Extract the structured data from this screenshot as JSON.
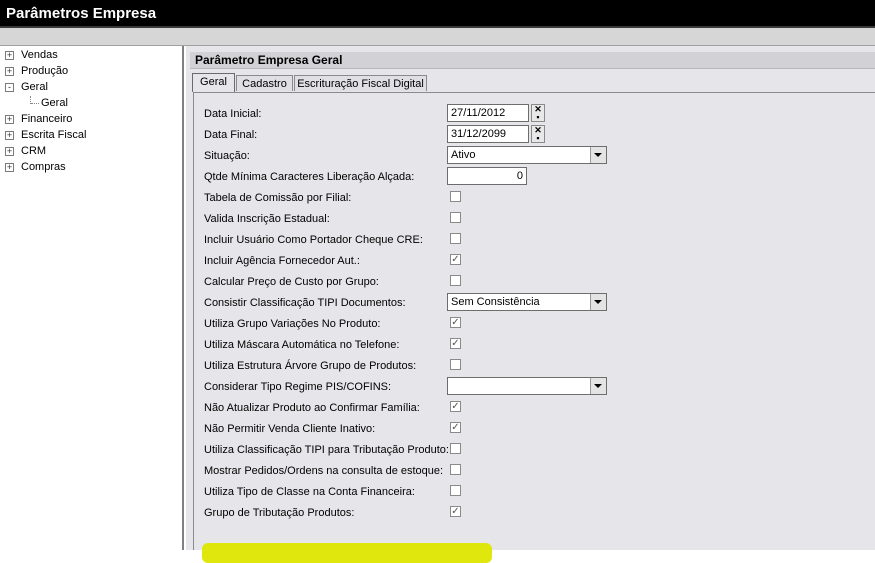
{
  "window": {
    "title": "Parâmetros Empresa"
  },
  "tree": {
    "items": [
      {
        "label": "Vendas",
        "expander": "+"
      },
      {
        "label": "Produção",
        "expander": "+"
      },
      {
        "label": "Geral",
        "expander": "-"
      },
      {
        "label": "Geral",
        "expander": ""
      },
      {
        "label": "Financeiro",
        "expander": "+"
      },
      {
        "label": "Escrita Fiscal",
        "expander": "+"
      },
      {
        "label": "CRM",
        "expander": "+"
      },
      {
        "label": "Compras",
        "expander": "+"
      }
    ]
  },
  "panel": {
    "title": "Parâmetro Empresa Geral"
  },
  "tabs": [
    {
      "label": "Geral",
      "active": true
    },
    {
      "label": "Cadastro",
      "active": false
    },
    {
      "label": "Escrituração Fiscal Digital",
      "active": false
    }
  ],
  "fields": {
    "data_inicial": {
      "label": "Data Inicial:",
      "value": "27/11/2012"
    },
    "data_final": {
      "label": "Data Final:",
      "value": "31/12/2099"
    },
    "situacao": {
      "label": "Situação:",
      "value": "Ativo"
    },
    "qtde_minima": {
      "label": "Qtde Mínima Caracteres Liberação Alçada:",
      "value": "0"
    },
    "tabela_comissao": {
      "label": "Tabela de Comissão por Filial:",
      "checked": false
    },
    "valida_inscricao": {
      "label": "Valida Inscrição Estadual:",
      "checked": false
    },
    "incluir_usuario": {
      "label": "Incluir Usuário Como Portador Cheque CRE:",
      "checked": false
    },
    "incluir_agencia": {
      "label": "Incluir Agência Fornecedor Aut.:",
      "checked": true
    },
    "calcular_preco": {
      "label": "Calcular Preço de Custo por Grupo:",
      "checked": false
    },
    "consistir_tipi": {
      "label": "Consistir Classificação TIPI Documentos:",
      "value": "Sem Consistência"
    },
    "utiliza_grupo_variacoes": {
      "label": "Utiliza Grupo Variações No Produto:",
      "checked": true
    },
    "utiliza_mascara": {
      "label": "Utiliza Máscara Automática no Telefone:",
      "checked": true
    },
    "utiliza_estrutura": {
      "label": "Utiliza Estrutura Árvore Grupo de Produtos:",
      "checked": false
    },
    "considerar_regime": {
      "label": "Considerar Tipo Regime PIS/COFINS:",
      "value": ""
    },
    "nao_atualizar": {
      "label": "Não Atualizar Produto ao Confirmar Família:",
      "checked": true
    },
    "nao_permitir": {
      "label": "Não Permitir Venda Cliente Inativo:",
      "checked": true
    },
    "utiliza_classificacao_tipi": {
      "label": "Utiliza Classificação TIPI para Tributação Produto:",
      "checked": false
    },
    "mostrar_pedidos": {
      "label": "Mostrar Pedidos/Ordens na consulta de estoque:",
      "checked": false
    },
    "utiliza_tipo_classe": {
      "label": "Utiliza Tipo de Classe na Conta Financeira:",
      "checked": false
    },
    "grupo_tributacao": {
      "label": "Grupo de Tributação Produtos:",
      "checked": true
    }
  },
  "colors": {
    "highlight": "#dde600",
    "titlebar": "#000000"
  }
}
